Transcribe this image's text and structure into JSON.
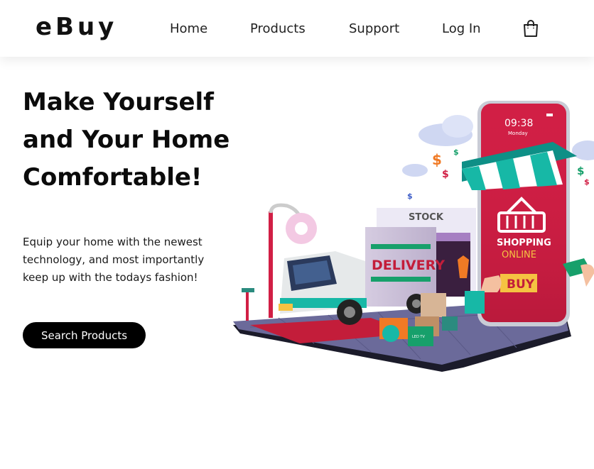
{
  "brand": {
    "name": "eBuy"
  },
  "nav": {
    "links": [
      {
        "label": "Home"
      },
      {
        "label": "Products"
      },
      {
        "label": "Support"
      },
      {
        "label": "Log In"
      }
    ],
    "cart_icon": "shopping-bag-icon"
  },
  "hero": {
    "title": "Make Yourself and Your Home Comfortable!",
    "description": "Equip your home with the newest technology, and most importantly keep up with the todays fashion!",
    "cta_label": "Search Products"
  },
  "illustration": {
    "phone_time": "09:38",
    "phone_day": "Monday",
    "shopping_label": "SHOPPING",
    "online_label": "ONLINE",
    "buy_label": "BUY",
    "stock_label": "STOCK",
    "delivery_label": "DELIVERY",
    "tv_box_label": "LED TV"
  },
  "colors": {
    "accent": "#000000",
    "phone_red": "#d11f45",
    "teal": "#17b8a6",
    "gold": "#f5c242"
  }
}
